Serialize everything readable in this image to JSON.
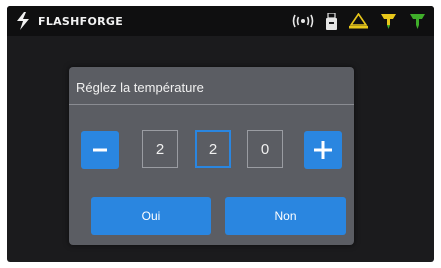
{
  "header": {
    "brand": "FLASHFORGE",
    "icons": [
      "flashforge-logo-icon",
      "wifi-icon",
      "usb-icon",
      "heated-bed-icon",
      "extruder-left-icon",
      "extruder-right-icon"
    ]
  },
  "dialog": {
    "title": "Réglez la température",
    "decrement_label": "−",
    "increment_label": "+",
    "digits": [
      "2",
      "2",
      "0"
    ],
    "active_digit_index": 1,
    "confirm_label": "Oui",
    "cancel_label": "Non"
  },
  "colors": {
    "accent": "#2a86e0",
    "dialog_bg": "#5b5d63",
    "screen_bg": "#1b1b1d",
    "status_yellow": "#e8c71a",
    "status_green": "#3fae2a"
  }
}
